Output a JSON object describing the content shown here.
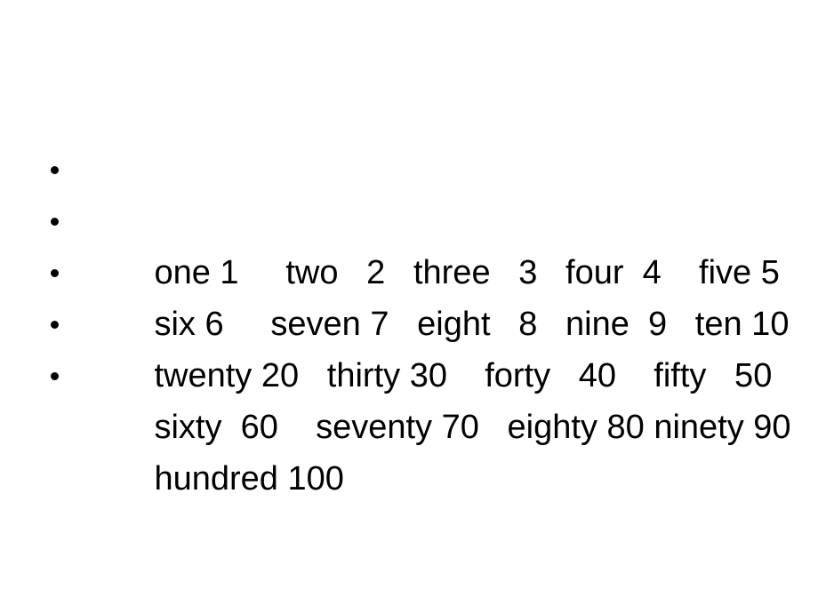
{
  "slide": {
    "background_color": "#ffffff",
    "text_color": "#000000",
    "bullet_glyph": "•",
    "body": {
      "items": [
        {
          "text": "one 1     two   2   three   3   four  4    five 5",
          "pairs": [
            {
              "word": "one",
              "number": "1"
            },
            {
              "word": "two",
              "number": "2"
            },
            {
              "word": "three",
              "number": "3"
            },
            {
              "word": "four",
              "number": "4"
            },
            {
              "word": "five",
              "number": "5"
            }
          ]
        },
        {
          "text": "six 6     seven 7   eight   8   nine  9   ten 10",
          "pairs": [
            {
              "word": "six",
              "number": "6"
            },
            {
              "word": "seven",
              "number": "7"
            },
            {
              "word": "eight",
              "number": "8"
            },
            {
              "word": "nine",
              "number": "9"
            },
            {
              "word": "ten",
              "number": "10"
            }
          ]
        },
        {
          "text": "twenty 20   thirty 30    forty   40    fifty   50",
          "pairs": [
            {
              "word": "twenty",
              "number": "20"
            },
            {
              "word": "thirty",
              "number": "30"
            },
            {
              "word": "forty",
              "number": "40"
            },
            {
              "word": "fifty",
              "number": "50"
            }
          ]
        },
        {
          "text": "sixty  60    seventy 70   eighty 80 ninety 90",
          "pairs": [
            {
              "word": "sixty",
              "number": "60"
            },
            {
              "word": "seventy",
              "number": "70"
            },
            {
              "word": "eighty",
              "number": "80"
            },
            {
              "word": "ninety",
              "number": "90"
            }
          ]
        },
        {
          "text": "hundred 100",
          "pairs": [
            {
              "word": "hundred",
              "number": "100"
            }
          ]
        }
      ]
    }
  }
}
